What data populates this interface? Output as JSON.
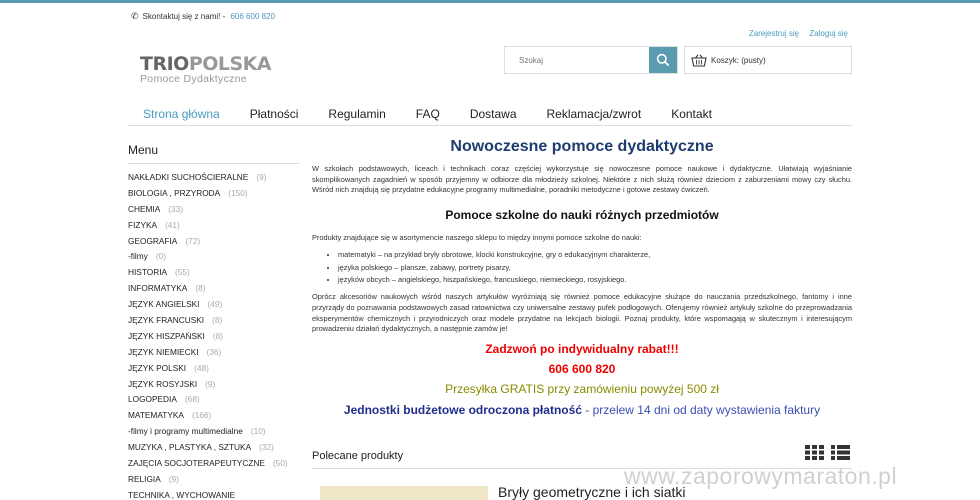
{
  "header": {
    "contact_label": "Skontaktuj się z nami!",
    "contact_sep": " - ",
    "contact_phone": "606 600 820",
    "register": "Zarejestruj się",
    "login": "Zaloguj się",
    "logo_part1": "TRIO",
    "logo_part2": "POLSKA",
    "logo_sub": "Pomoce Dydaktyczne",
    "search_placeholder": "Szukaj",
    "cart": "Koszyk: (pusty)"
  },
  "nav": [
    "Strona główna",
    "Płatności",
    "Regulamin",
    "FAQ",
    "Dostawa",
    "Reklamacja/zwrot",
    "Kontakt"
  ],
  "sidebar": {
    "title": "Menu",
    "items": [
      {
        "label": "NAKŁADKI SUCHOŚCIERALNE",
        "count": "(9)"
      },
      {
        "label": "BIOLOGIA , PRZYRODA",
        "count": "(150)"
      },
      {
        "label": "CHEMIA",
        "count": "(33)"
      },
      {
        "label": "FIZYKA",
        "count": "(41)"
      },
      {
        "label": "GEOGRAFIA",
        "count": "(72)"
      },
      {
        "label": "-filmy",
        "count": "(0)"
      },
      {
        "label": "HISTORIA",
        "count": "(55)"
      },
      {
        "label": "INFORMATYKA",
        "count": "(8)"
      },
      {
        "label": "JĘZYK ANGIELSKI",
        "count": "(49)"
      },
      {
        "label": "JĘZYK FRANCUSKI",
        "count": "(8)"
      },
      {
        "label": "JĘZYK HISZPAŃSKI",
        "count": "(8)"
      },
      {
        "label": "JĘZYK NIEMIECKI",
        "count": "(36)"
      },
      {
        "label": "JĘZYK POLSKI",
        "count": "(48)"
      },
      {
        "label": "JĘZYK ROSYJSKI",
        "count": "(9)"
      },
      {
        "label": "LOGOPEDIA",
        "count": "(68)"
      },
      {
        "label": "MATEMATYKA",
        "count": "(166)"
      },
      {
        "label": "-filmy i programy multimedialne",
        "count": "(10)"
      },
      {
        "label": "MUZYKA , PLASTYKA , SZTUKA",
        "count": "(32)"
      },
      {
        "label": "ZAJĘCIA SOCJOTERAPEUTYCZNE",
        "count": "(50)"
      },
      {
        "label": "RELIGIA",
        "count": "(9)"
      },
      {
        "label": "TECHNIKA , WYCHOWANIE",
        "count": ""
      }
    ]
  },
  "main": {
    "title": "Nowoczesne pomoce dydaktyczne",
    "intro": "W szkołach podstawowych, liceach i technikach coraz częściej wykorzystuje się nowoczesne pomoce naukowe i dydaktyczne. Ułatwiają wyjaśnianie skomplikowanych zagadnień w sposób przyjemny w odbiorze dla młodzieży szkolnej. Niektóre z nich służą również dzieciom z zaburzeniami mowy czy słuchu. Wśród nich znajdują się przydatne edukacyjne programy multimedialne, poradniki metodyczne i gotowe zestawy ćwiczeń.",
    "subtitle": "Pomoce szkolne do nauki różnych przedmiotów",
    "lead": "Produkty znajdujące się w asortymencie naszego sklepu to między innymi pomoce szkolne do nauki:",
    "bullets": [
      "matematyki – na przykład bryły obrotowe, klocki konstrukcyjne, gry o edukacyjnym charakterze,",
      "języka polskiego – plansze, zabawy, portrety pisarzy,",
      "języków obcych – angielskiego, hiszpańskiego, francuskiego, niemieckiego, rosyjskiego."
    ],
    "para2": "Oprócz akcesoriów naukowych wśród naszych artykułów wyróżniają się również pomoce edukacyjne służące do nauczania przedszkolnego, fantomy i inne przyrządy do poznawania podstawowych zasad ratownictwa czy uniwersalne zestawy pufek podłogowych. Oferujemy również artykuły szkolne do przeprowadzania eksperymentów chemicznych i przyrodniczych oraz modele przydatne na lekcjach biologii. Poznaj produkty, które wspomagają w skutecznym i interesującym prowadzeniu działań dydaktycznych, a następnie zamów je!",
    "promo_rabat": "Zadzwoń po indywidualny rabat!!!",
    "promo_phone": "606 600 820",
    "promo_free": "Przesyłka GRATIS przy zamówieniu powyżej 500 zł",
    "promo_budget_bold": "Jednostki budżetowe odroczona płatność",
    "promo_budget_rest": " - przelew 14 dni od daty wystawienia faktury"
  },
  "featured": {
    "title": "Polecane produkty",
    "product_title": "Bryły geometryczne i ich siatki"
  },
  "watermark": "www.zaporowymaraton.pl",
  "colors": {
    "accent": "#4a9bbd",
    "heading": "#1f3c6e",
    "promo_red": "#e00000",
    "promo_olive": "#8a8a00",
    "promo_blue": "#1f2d8a"
  }
}
